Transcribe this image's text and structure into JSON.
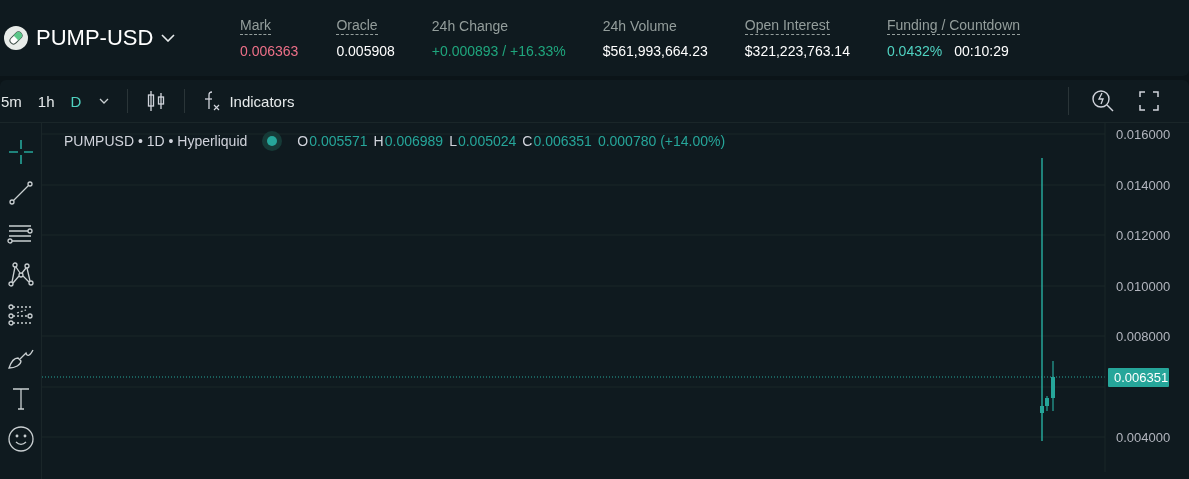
{
  "market": {
    "symbol": "PUMP-USD"
  },
  "stats": [
    {
      "label": "Mark",
      "underlined": true,
      "values": [
        {
          "text": "0.006363",
          "color": "#ed7088"
        }
      ]
    },
    {
      "label": "Oracle",
      "underlined": true,
      "values": [
        {
          "text": "0.005908",
          "color": "#ffffff"
        }
      ]
    },
    {
      "label": "24h Change",
      "underlined": false,
      "values": [
        {
          "text": "+0.000893 / +16.33%",
          "color": "#1fa67d"
        }
      ]
    },
    {
      "label": "24h Volume",
      "underlined": false,
      "values": [
        {
          "text": "$561,993,664.23",
          "color": "#ffffff"
        }
      ]
    },
    {
      "label": "Open Interest",
      "underlined": true,
      "values": [
        {
          "text": "$321,223,763.14",
          "color": "#ffffff"
        }
      ]
    },
    {
      "label": "Funding / Countdown",
      "underlined": true,
      "values": [
        {
          "text": "0.0432%",
          "color": "#50d2c1"
        },
        {
          "text": "00:10:29",
          "color": "#ffffff"
        }
      ]
    }
  ],
  "toolbar": {
    "intervals": [
      {
        "label": "5m",
        "selected": false
      },
      {
        "label": "1h",
        "selected": false
      },
      {
        "label": "D",
        "selected": true
      }
    ],
    "indicators": "Indicators"
  },
  "drawing_tools": [
    {
      "kind": "crosshair",
      "selected": true
    },
    {
      "kind": "trend-line",
      "selected": false
    },
    {
      "kind": "lines",
      "selected": false
    },
    {
      "kind": "pattern",
      "selected": false
    },
    {
      "kind": "projection",
      "selected": false
    },
    {
      "kind": "brush",
      "selected": false
    },
    {
      "kind": "text",
      "selected": false
    },
    {
      "kind": "emoji",
      "selected": false
    }
  ],
  "legend": {
    "title": "PUMPUSD • 1D • Hyperliquid",
    "ohlc": [
      {
        "key": "O",
        "value": "0.005571"
      },
      {
        "key": "H",
        "value": "0.006989"
      },
      {
        "key": "L",
        "value": "0.005024"
      },
      {
        "key": "C",
        "value": "0.006351"
      }
    ],
    "change": "0.000780 (+14.00%)"
  },
  "price_axis": [
    "0.016000",
    "0.014000",
    "0.012000",
    "0.010000",
    "0.008000",
    "0.004000"
  ],
  "last_price": "0.006351"
}
